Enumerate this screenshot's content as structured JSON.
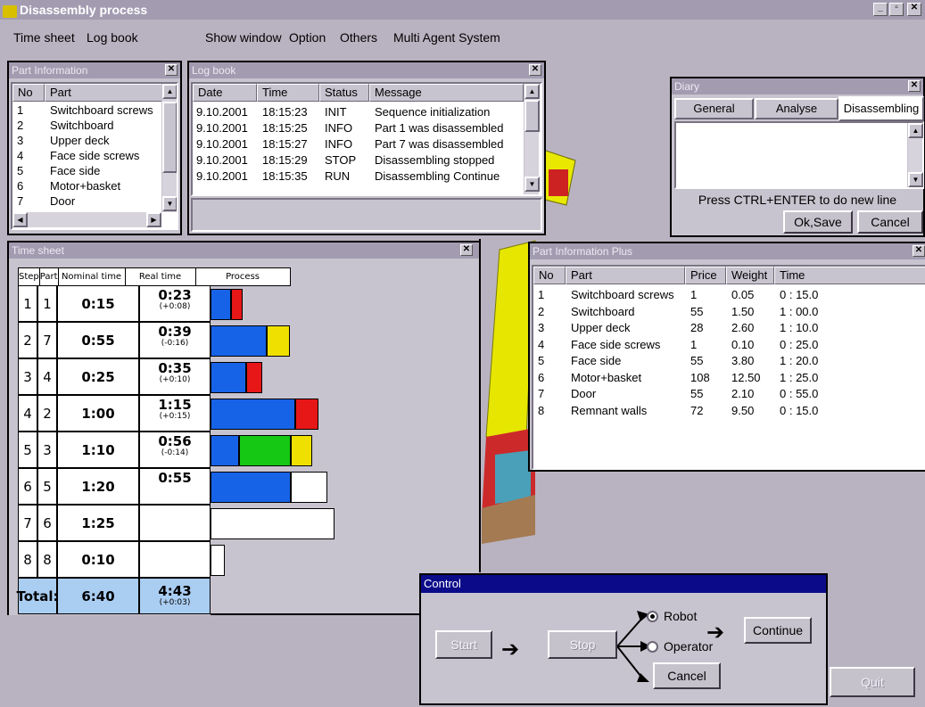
{
  "app": {
    "title": "Disassembly process",
    "icon": "robot-app-icon"
  },
  "menu": {
    "items": [
      "Time sheet",
      "Log book",
      "Show window",
      "Option",
      "Others",
      "Multi Agent System"
    ]
  },
  "part_info": {
    "title": "Part Information",
    "headers": [
      "No",
      "Part"
    ],
    "rows": [
      [
        "1",
        "Switchboard screws"
      ],
      [
        "2",
        "Switchboard"
      ],
      [
        "3",
        "Upper deck"
      ],
      [
        "4",
        "Face side screws"
      ],
      [
        "5",
        "Face side"
      ],
      [
        "6",
        "Motor+basket"
      ],
      [
        "7",
        "Door"
      ]
    ]
  },
  "log_book": {
    "title": "Log book",
    "headers": [
      "Date",
      "Time",
      "Status",
      "Message"
    ],
    "rows": [
      [
        "9.10.2001",
        "18:15:23",
        "INIT",
        "Sequence initialization"
      ],
      [
        "9.10.2001",
        "18:15:25",
        "INFO",
        "Part 1 was disassembled"
      ],
      [
        "9.10.2001",
        "18:15:27",
        "INFO",
        "Part 7 was disassembled"
      ],
      [
        "9.10.2001",
        "18:15:29",
        "STOP",
        "Disassembling stopped"
      ],
      [
        "9.10.2001",
        "18:15:35",
        "RUN",
        "Disassembling Continue"
      ]
    ]
  },
  "diary": {
    "title": "Diary",
    "tabs": [
      "General",
      "Analyse",
      "Disassembling"
    ],
    "active_tab": "Disassembling",
    "hint": "Press CTRL+ENTER to do new line",
    "ok_label": "Ok,Save",
    "cancel_label": "Cancel"
  },
  "time_sheet": {
    "title": "Time sheet",
    "headers": [
      "Step",
      "Part",
      "Nominal time",
      "Real time",
      "Process"
    ],
    "rows": [
      {
        "step": "1",
        "part": "1",
        "nominal": "0:15",
        "real": "0:23",
        "diff": "(+0:08)"
      },
      {
        "step": "2",
        "part": "7",
        "nominal": "0:55",
        "real": "0:39",
        "diff": "(-0:16)"
      },
      {
        "step": "3",
        "part": "4",
        "nominal": "0:25",
        "real": "0:35",
        "diff": "(+0:10)"
      },
      {
        "step": "4",
        "part": "2",
        "nominal": "1:00",
        "real": "1:15",
        "diff": "(+0:15)"
      },
      {
        "step": "5",
        "part": "3",
        "nominal": "1:10",
        "real": "0:56",
        "diff": "(-0:14)"
      },
      {
        "step": "6",
        "part": "5",
        "nominal": "1:20",
        "real": "0:55",
        "diff": ""
      },
      {
        "step": "7",
        "part": "6",
        "nominal": "1:25",
        "real": "",
        "diff": ""
      },
      {
        "step": "8",
        "part": "8",
        "nominal": "0:10",
        "real": "",
        "diff": ""
      }
    ],
    "total": {
      "label": "Total:",
      "nominal": "6:40",
      "real": "4:43",
      "diff": "(+0:03)"
    },
    "process_bars": [
      [
        {
          "c": "#1763e8",
          "v": 0.23
        },
        {
          "c": "#e81717",
          "v": 0.13
        }
      ],
      [
        {
          "c": "#1763e8",
          "v": 0.63
        },
        {
          "c": "#f0e000",
          "v": 0.26
        }
      ],
      [
        {
          "c": "#1763e8",
          "v": 0.4
        },
        {
          "c": "#e81717",
          "v": 0.18
        }
      ],
      [
        {
          "c": "#1763e8",
          "v": 0.95
        },
        {
          "c": "#e81717",
          "v": 0.26
        }
      ],
      [
        {
          "c": "#1763e8",
          "v": 0.32
        },
        {
          "c": "#14c814",
          "v": 0.58
        },
        {
          "c": "#f0e000",
          "v": 0.24
        }
      ],
      [
        {
          "c": "#1763e8",
          "v": 0.9
        },
        {
          "c": "#ffffff",
          "v": 0.41
        }
      ],
      [
        {
          "c": "#ffffff",
          "v": 1.39
        }
      ],
      [
        {
          "c": "#ffffff",
          "v": 0.16
        }
      ]
    ],
    "colors": {
      "blue": "#1763e8",
      "red": "#e81717",
      "yellow": "#f0e000",
      "green": "#14c814",
      "total_bg": "#aacdf2"
    }
  },
  "part_plus": {
    "title": "Part Information Plus",
    "headers": [
      "No",
      "Part",
      "Price",
      "Weight",
      "Time"
    ],
    "rows": [
      [
        "1",
        "Switchboard screws",
        "1",
        "0.05",
        "0 : 15.0"
      ],
      [
        "2",
        "Switchboard",
        "55",
        "1.50",
        "1 : 00.0"
      ],
      [
        "3",
        "Upper deck",
        "28",
        "2.60",
        "1 : 10.0"
      ],
      [
        "4",
        "Face side screws",
        "1",
        "0.10",
        "0 : 25.0"
      ],
      [
        "5",
        "Face side",
        "55",
        "3.80",
        "1 : 20.0"
      ],
      [
        "6",
        "Motor+basket",
        "108",
        "12.50",
        "1 : 25.0"
      ],
      [
        "7",
        "Door",
        "55",
        "2.10",
        "0 : 55.0"
      ],
      [
        "8",
        "Remnant walls",
        "72",
        "9.50",
        "0 : 15.0"
      ]
    ]
  },
  "control": {
    "title": "Control",
    "start": "Start",
    "stop": "Stop",
    "robot": "Robot",
    "operator": "Operator",
    "continue": "Continue",
    "cancel": "Cancel",
    "robot_selected": true
  },
  "quit_label": "Quit"
}
